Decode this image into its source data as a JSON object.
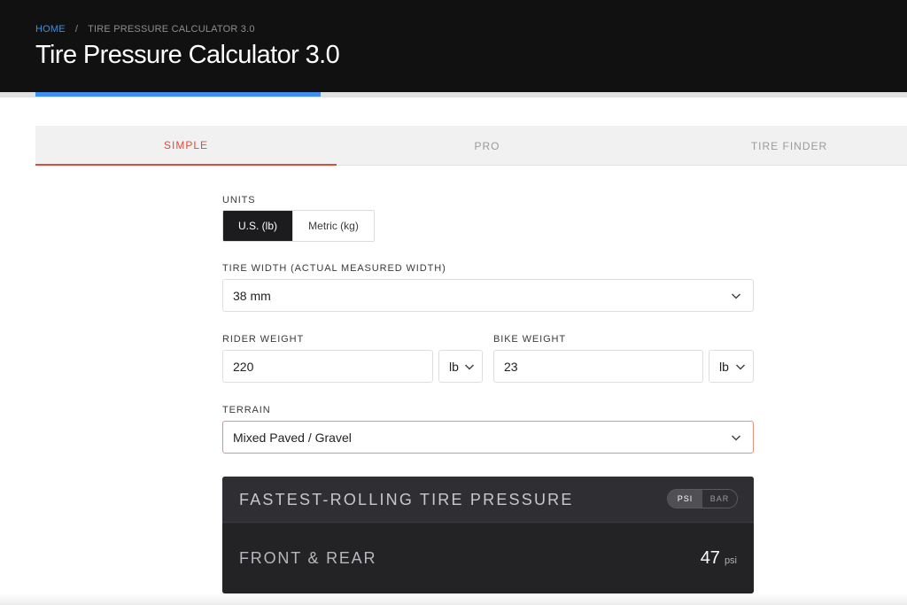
{
  "breadcrumb": {
    "home": "HOME",
    "separator": "/",
    "current": "TIRE PRESSURE CALCULATOR 3.0"
  },
  "page": {
    "title": "Tire Pressure Calculator 3.0"
  },
  "tabs": [
    {
      "label": "SIMPLE",
      "active": true
    },
    {
      "label": "PRO",
      "active": false
    },
    {
      "label": "TIRE FINDER",
      "active": false
    }
  ],
  "units": {
    "label": "UNITS",
    "options": [
      "U.S. (lb)",
      "Metric (kg)"
    ],
    "selected": "U.S. (lb)"
  },
  "tire_width": {
    "label": "TIRE WIDTH (ACTUAL MEASURED WIDTH)",
    "value": "38 mm"
  },
  "rider_weight": {
    "label": "RIDER WEIGHT",
    "value": "220",
    "unit": "lb"
  },
  "bike_weight": {
    "label": "BIKE WEIGHT",
    "value": "23",
    "unit": "lb"
  },
  "terrain": {
    "label": "TERRAIN",
    "value": "Mixed Paved / Gravel"
  },
  "result": {
    "title": "FASTEST-ROLLING TIRE PRESSURE",
    "unit_options": [
      "PSI",
      "BAR"
    ],
    "selected_unit": "PSI",
    "row_label": "FRONT & REAR",
    "value": "47",
    "value_unit": "psi"
  },
  "colors": {
    "accent": "#e14b3b",
    "progress": "#3f8ef0",
    "header_bg": "#111112",
    "link": "#3b8fe0"
  },
  "icons": {
    "dropdown": "chevron-down-icon"
  }
}
